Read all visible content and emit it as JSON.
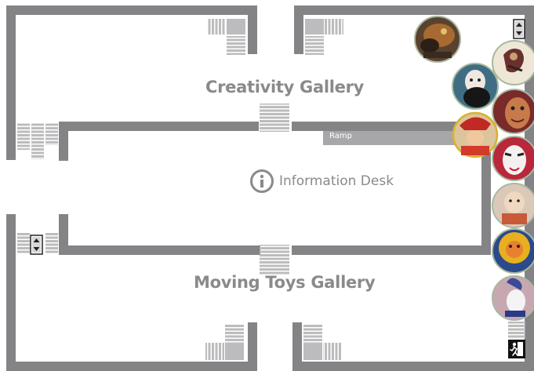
{
  "galleries": {
    "creativity": "Creativity Gallery",
    "moving_toys": "Moving Toys Gallery"
  },
  "ramp": {
    "label": "Ramp"
  },
  "information_desk": {
    "label": "Information Desk",
    "icon": "info-icon"
  },
  "icons": {
    "elevator_top": "elevator-icon",
    "elevator_left": "elevator-icon",
    "emergency_exit": "emergency-exit-icon"
  },
  "exhibit_thumbnails": [
    {
      "subject": "lion-dance-puppet"
    },
    {
      "subject": "bearded-puppet-head"
    },
    {
      "subject": "shadow-puppet"
    },
    {
      "subject": "painted-mask"
    },
    {
      "subject": "opera-mask"
    },
    {
      "subject": "red-hat-figure"
    },
    {
      "subject": "painted-doll"
    },
    {
      "subject": "golden-lion-head"
    },
    {
      "subject": "marionette-white-face"
    }
  ],
  "colors": {
    "wall": "#848487",
    "stairs": "#bcbcbe",
    "ramp": "#a7a7aa",
    "label": "#8a8a8d",
    "thumbnail_border": "#a8b8a0",
    "thumbnail_highlight_border": "#d9b22a"
  }
}
